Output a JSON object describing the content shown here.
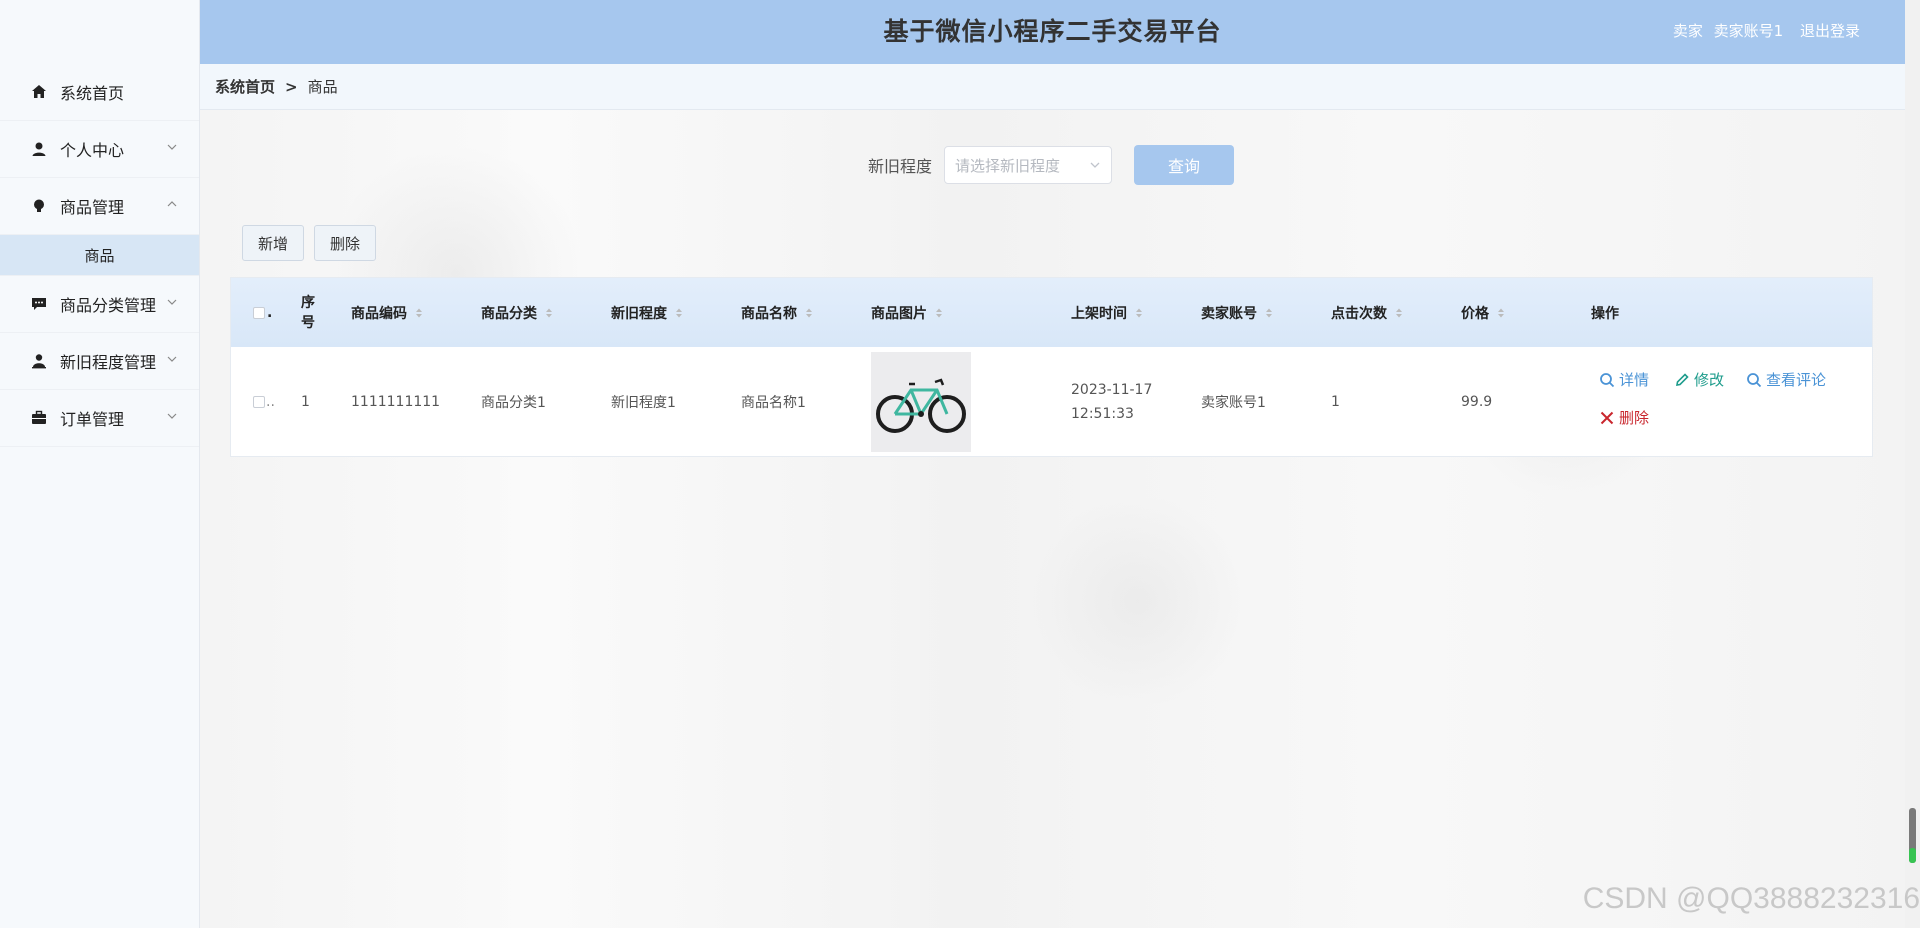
{
  "header": {
    "title": "基于微信小程序二手交易平台",
    "role": "卖家",
    "username": "卖家账号1",
    "logout": "退出登录"
  },
  "sidebar": {
    "items": [
      {
        "label": "系统首页",
        "icon": "home-icon"
      },
      {
        "label": "个人中心",
        "icon": "user-icon"
      },
      {
        "label": "商品管理",
        "icon": "bulb-icon",
        "expanded": true,
        "children": [
          {
            "label": "商品"
          }
        ]
      },
      {
        "label": "商品分类管理",
        "icon": "chat-icon"
      },
      {
        "label": "新旧程度管理",
        "icon": "person-icon"
      },
      {
        "label": "订单管理",
        "icon": "briefcase-icon"
      }
    ]
  },
  "breadcrumb": {
    "home": "系统首页",
    "sep": ">",
    "current": "商品"
  },
  "search": {
    "label": "新旧程度",
    "placeholder": "请选择新旧程度",
    "button": "查询"
  },
  "toolbar": {
    "add": "新增",
    "delete": "删除"
  },
  "table": {
    "headers": {
      "select": "",
      "index": "序号",
      "code": "商品编码",
      "category": "商品分类",
      "condition": "新旧程度",
      "name": "商品名称",
      "image": "商品图片",
      "time": "上架时间",
      "seller": "卖家账号",
      "clicks": "点击次数",
      "price": "价格",
      "ops": "操作"
    },
    "rows": [
      {
        "index": "1",
        "code": "1111111111",
        "category": "商品分类1",
        "condition": "新旧程度1",
        "name": "商品名称1",
        "image": "bicycle-image",
        "date": "2023-11-17",
        "time": "12:51:33",
        "seller": "卖家账号1",
        "clicks": "1",
        "price": "99.9"
      }
    ],
    "ops": {
      "detail": "详情",
      "edit": "修改",
      "comments": "查看评论",
      "delete": "删除"
    }
  },
  "watermark": "CSDN @QQ3888232316",
  "colors": {
    "accent": "#a6c7ee",
    "link": "#4a93d6",
    "edit": "#1e9c8c",
    "danger": "#c9262d"
  }
}
